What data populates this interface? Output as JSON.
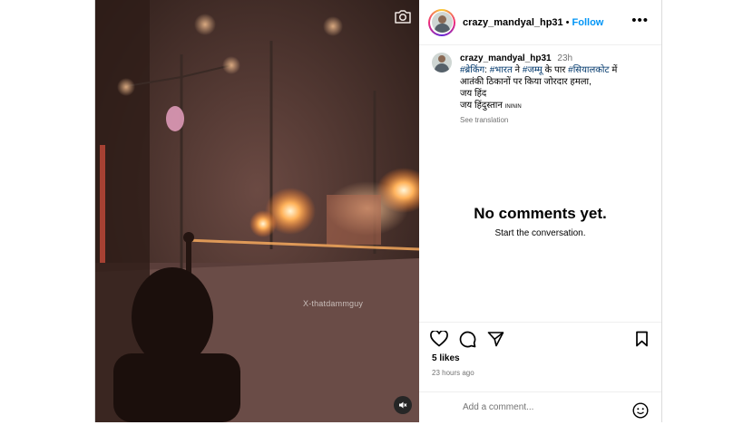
{
  "post": {
    "username": "crazy_mandyal_hp31",
    "follow_label": "Follow",
    "dot": "•",
    "more_label": "•••",
    "media": {
      "watermark": "X-thatdammguy"
    }
  },
  "caption": {
    "username": "crazy_mandyal_hp31",
    "time": "23h",
    "line1_tag1": "#ब्रेकिंग",
    "line1_sep": ": ",
    "line1_tag2": "#भारत",
    "line1_mid": " ने ",
    "line1_tag3": "#जम्मू",
    "line1_mid2": " के पार ",
    "line1_tag4": "#सियालकोट",
    "line1_end": " में",
    "line2": "आतंकी ठिकानों पर किया जोरदार हमला,",
    "line3": "जय हिंद",
    "line4": "जय हिंदुस्तान",
    "line4_small": "INININ",
    "see_translation": "See translation"
  },
  "comments": {
    "empty_title": "No comments yet.",
    "empty_subtitle": "Start the conversation."
  },
  "actions": {
    "likes": "5 likes",
    "posted": "23 hours ago"
  },
  "comment_box": {
    "placeholder": "Add a comment..."
  },
  "icons": {
    "camera": "camera-icon",
    "mute": "speaker-muted-icon",
    "like": "heart-icon",
    "comment": "comment-bubble-icon",
    "share": "paper-plane-icon",
    "save": "bookmark-icon",
    "emoji": "smiley-icon"
  }
}
